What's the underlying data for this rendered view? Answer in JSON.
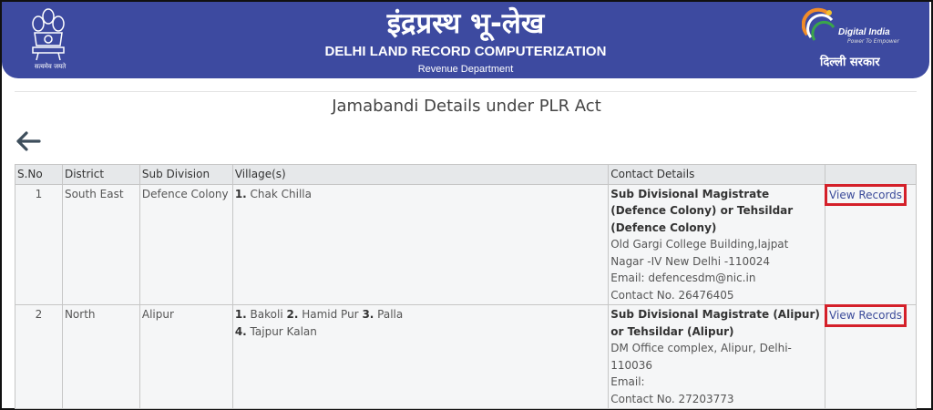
{
  "header": {
    "hindi_title": "इंद्रप्रस्थ भू-लेख",
    "title": "DELHI LAND RECORD COMPUTERIZATION",
    "department": "Revenue Department",
    "emblem_motto": "सत्यमेव जयते",
    "digital_india_text": "Digital India",
    "digital_india_tagline": "Power To Empower",
    "delhi_govt_text": "दिल्ली सरकार",
    "bg_color": "#3d4aa0"
  },
  "page": {
    "heading": "Jamabandi Details under PLR Act"
  },
  "table": {
    "headers": [
      "S.No",
      "District",
      "Sub Division",
      "Village(s)",
      "Contact Details",
      ""
    ],
    "rows": [
      {
        "sno": "1",
        "district": "South East",
        "sub_division": "Defence Colony",
        "villages": [
          {
            "num": "1.",
            "name": " Chak Chilla"
          }
        ],
        "contact_title": "Sub Divisional Magistrate (Defence Colony) or Tehsildar (Defence Colony)",
        "address": "Old Gargi College Building,lajpat Nagar -IV New Delhi -110024",
        "email": "Email: defencesdm@nic.in",
        "phone": "Contact No. 26476405",
        "action": "View Records"
      },
      {
        "sno": "2",
        "district": "North",
        "sub_division": "Alipur",
        "villages": [
          {
            "num": "1.",
            "name": " Bakoli "
          },
          {
            "num": "2.",
            "name": " Hamid Pur "
          },
          {
            "num": "3.",
            "name": " Palla"
          },
          {
            "num": "4.",
            "name": " Tajpur Kalan"
          }
        ],
        "contact_title": "Sub Divisional Magistrate (Alipur) or Tehsildar (Alipur)",
        "address": "DM Office complex, Alipur, Delhi-110036",
        "email": "Email:",
        "phone": "Contact No. 27203773",
        "action": "View Records"
      }
    ]
  },
  "icons": {
    "back": "arrow-left-icon",
    "emblem": "national-emblem-icon",
    "digital_india": "digital-india-logo-icon"
  }
}
